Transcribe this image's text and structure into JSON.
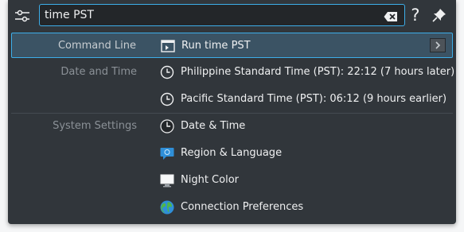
{
  "search": {
    "value": "time PST"
  },
  "help_label": "?",
  "results": [
    {
      "category": "Command Line",
      "label": "Run time PST",
      "icon": "terminal-icon",
      "selected": true
    },
    {
      "category": "Date and Time",
      "label": "Philippine Standard Time (PST): 22:12 (7 hours later)",
      "icon": "clock-icon"
    },
    {
      "category": "",
      "label": "Pacific Standard Time (PST): 06:12 (9 hours earlier)",
      "icon": "clock-icon"
    },
    {
      "category": "System Settings",
      "label": "Date & Time",
      "icon": "clock-settings-icon"
    },
    {
      "category": "",
      "label": "Region & Language",
      "icon": "region-language-icon"
    },
    {
      "category": "",
      "label": "Night Color",
      "icon": "monitor-icon"
    },
    {
      "category": "",
      "label": "Connection Preferences",
      "icon": "globe-icon"
    }
  ],
  "colors": {
    "accent": "#3daee9",
    "background": "#31363b",
    "selected": "#3b5364"
  }
}
